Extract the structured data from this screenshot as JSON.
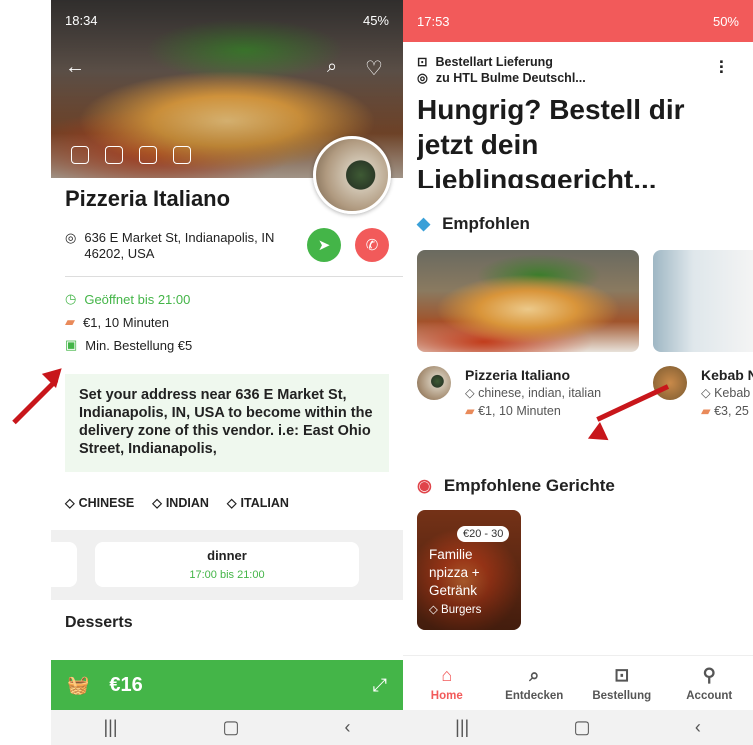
{
  "left": {
    "status": {
      "time": "18:34",
      "right": "45%"
    },
    "title": "Pizzeria Italiano",
    "address": "636 E Market St, Indianapolis, IN 46202, USA",
    "open": "Geöffnet bis 21:00",
    "delivery": "€1, 10 Minuten",
    "min_order": "Min. Bestellung €5",
    "notice": "Set your address near 636 E Market St, Indianapolis, IN, USA to become within the delivery zone of this vendor. i.e: East Ohio Street, Indianapolis,",
    "tags": [
      "CHINESE",
      "INDIAN",
      "ITALIAN"
    ],
    "menu_card": {
      "title": "dinner",
      "time": "17:00 bis 21:00"
    },
    "section": "Desserts",
    "cart_total": "€16"
  },
  "right": {
    "status": {
      "time": "17:53",
      "right": "50%"
    },
    "order_type": "Bestellart Lieferung",
    "address": "zu HTL Bulme Deutschl...",
    "headline": "Hungrig? Bestell dir jetzt dein Lieblingsgericht...",
    "recommended": "Empfohlen",
    "vendor1": {
      "name": "Pizzeria Italiano",
      "tags": "chinese, indian, italian",
      "delivery": "€1, 10 Minuten"
    },
    "vendor2": {
      "name": "Kebab N",
      "tags": "Kebab",
      "delivery": "€3, 25"
    },
    "dishes_title": "Empfohlene Gerichte",
    "dish": {
      "price": "€20 - 30",
      "name": "Familie npizza + Getränk",
      "tag": "Burgers"
    },
    "nav": [
      "Home",
      "Entdecken",
      "Bestellung",
      "Account"
    ]
  },
  "colors": {
    "accent": "#f25a5a",
    "green": "#44b548",
    "call": "#f25a5a",
    "arrow": "#c8161b"
  }
}
